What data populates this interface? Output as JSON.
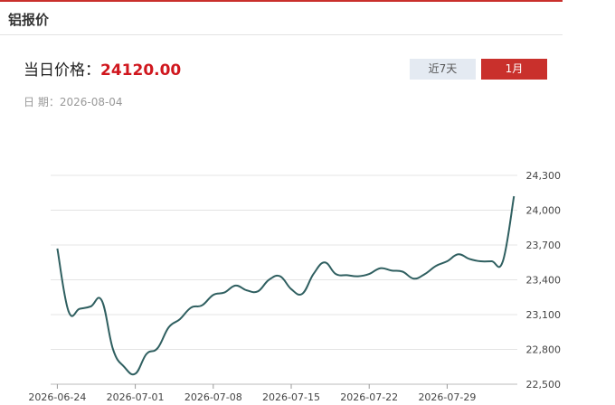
{
  "header": {
    "title": "铝报价"
  },
  "price": {
    "label": "当日价格：",
    "value": "24120.00"
  },
  "buttons": {
    "week": "近7天",
    "month": "1月",
    "active": "month"
  },
  "date": {
    "label": "日 期：",
    "value": "2026-08-04"
  },
  "colors": {
    "accent": "#c9302c",
    "line": "#2f5f60",
    "price": "#d0171e",
    "inactive_button": "#e4eaf2"
  },
  "chart_data": {
    "type": "line",
    "title": "",
    "xlabel": "",
    "ylabel": "",
    "ylim": [
      22500,
      24300
    ],
    "yticks": [
      22500,
      22800,
      23100,
      23400,
      23700,
      24000,
      24300
    ],
    "ytick_labels": [
      "22,500",
      "22,800",
      "23,100",
      "23,400",
      "23,700",
      "24,000",
      "24,300"
    ],
    "xtick_labels": [
      "2026-06-24",
      "2026-07-01",
      "2026-07-08",
      "2026-07-15",
      "2026-07-22",
      "2026-07-29"
    ],
    "grid": true,
    "series": [
      {
        "x": [
          "2026-06-24",
          "2026-06-25",
          "2026-06-26",
          "2026-06-27",
          "2026-06-28",
          "2026-06-29",
          "2026-06-30",
          "2026-07-01",
          "2026-07-02",
          "2026-07-03",
          "2026-07-04",
          "2026-07-05",
          "2026-07-06",
          "2026-07-07",
          "2026-07-08",
          "2026-07-09",
          "2026-07-10",
          "2026-07-11",
          "2026-07-12",
          "2026-07-13",
          "2026-07-14",
          "2026-07-15",
          "2026-07-16",
          "2026-07-17",
          "2026-07-18",
          "2026-07-19",
          "2026-07-20",
          "2026-07-21",
          "2026-07-22",
          "2026-07-23",
          "2026-07-24",
          "2026-07-25",
          "2026-07-26",
          "2026-07-27",
          "2026-07-28",
          "2026-07-29",
          "2026-07-30",
          "2026-07-31",
          "2026-08-01",
          "2026-08-02",
          "2026-08-03",
          "2026-08-04"
        ],
        "values": [
          23670,
          23130,
          23150,
          23170,
          23220,
          22800,
          22650,
          22590,
          22760,
          22810,
          22990,
          23060,
          23160,
          23180,
          23270,
          23290,
          23350,
          23310,
          23300,
          23400,
          23430,
          23320,
          23280,
          23450,
          23550,
          23450,
          23440,
          23430,
          23450,
          23500,
          23480,
          23470,
          23410,
          23450,
          23520,
          23560,
          23620,
          23580,
          23560,
          23560,
          23560,
          24120
        ]
      }
    ]
  }
}
